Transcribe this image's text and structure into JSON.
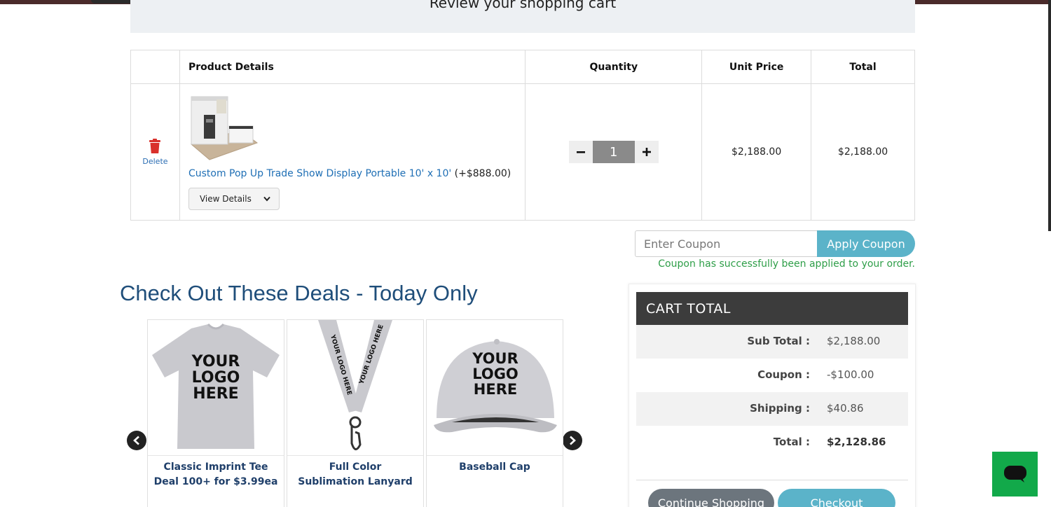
{
  "header": {
    "title": "Review your shopping cart"
  },
  "cart_table": {
    "columns": [
      "",
      "Product Details",
      "Quantity",
      "Unit Price",
      "Total"
    ],
    "items": [
      {
        "delete_label": "Delete",
        "product_name": "Custom Pop Up Trade Show Display Portable 10' x 10'",
        "product_extra": "(+$888.00)",
        "view_details_label": "View Details",
        "quantity": "1",
        "unit_price": "$2,188.00",
        "total": "$2,188.00"
      }
    ]
  },
  "coupon": {
    "placeholder": "Enter Coupon",
    "apply_label": "Apply Coupon",
    "success_message": "Coupon has successfully been applied to your order."
  },
  "deals": {
    "title": "Check Out These Deals - Today Only",
    "items": [
      {
        "line1": "Classic Imprint Tee",
        "line2": "Deal 100+ for $3.99ea",
        "image_text": [
          "YOUR",
          "LOGO",
          "HERE"
        ]
      },
      {
        "line1": "Full Color",
        "line2": "Sublimation Lanyard",
        "image_text": [
          "YOUR LOGO HERE"
        ]
      },
      {
        "line1": "Baseball Cap",
        "line2": "",
        "image_text": [
          "YOUR",
          "LOGO",
          "HERE"
        ]
      }
    ]
  },
  "cart_total": {
    "title": "CART  TOTAL",
    "rows": [
      {
        "label": "Sub Total :",
        "value": "$2,188.00"
      },
      {
        "label": "Coupon :",
        "value": "-$100.00"
      },
      {
        "label": "Shipping :",
        "value": "$40.86"
      },
      {
        "label": "Total :",
        "value": "$2,128.86"
      }
    ],
    "continue_label": "Continue Shopping",
    "checkout_label": "Checkout"
  },
  "colors": {
    "accent": "#5bb3c9",
    "link": "#1f6fb5",
    "success": "#2e9e48",
    "delete": "#d9302b",
    "chat": "#12a94a",
    "dark_header": "#3c3c3c"
  }
}
